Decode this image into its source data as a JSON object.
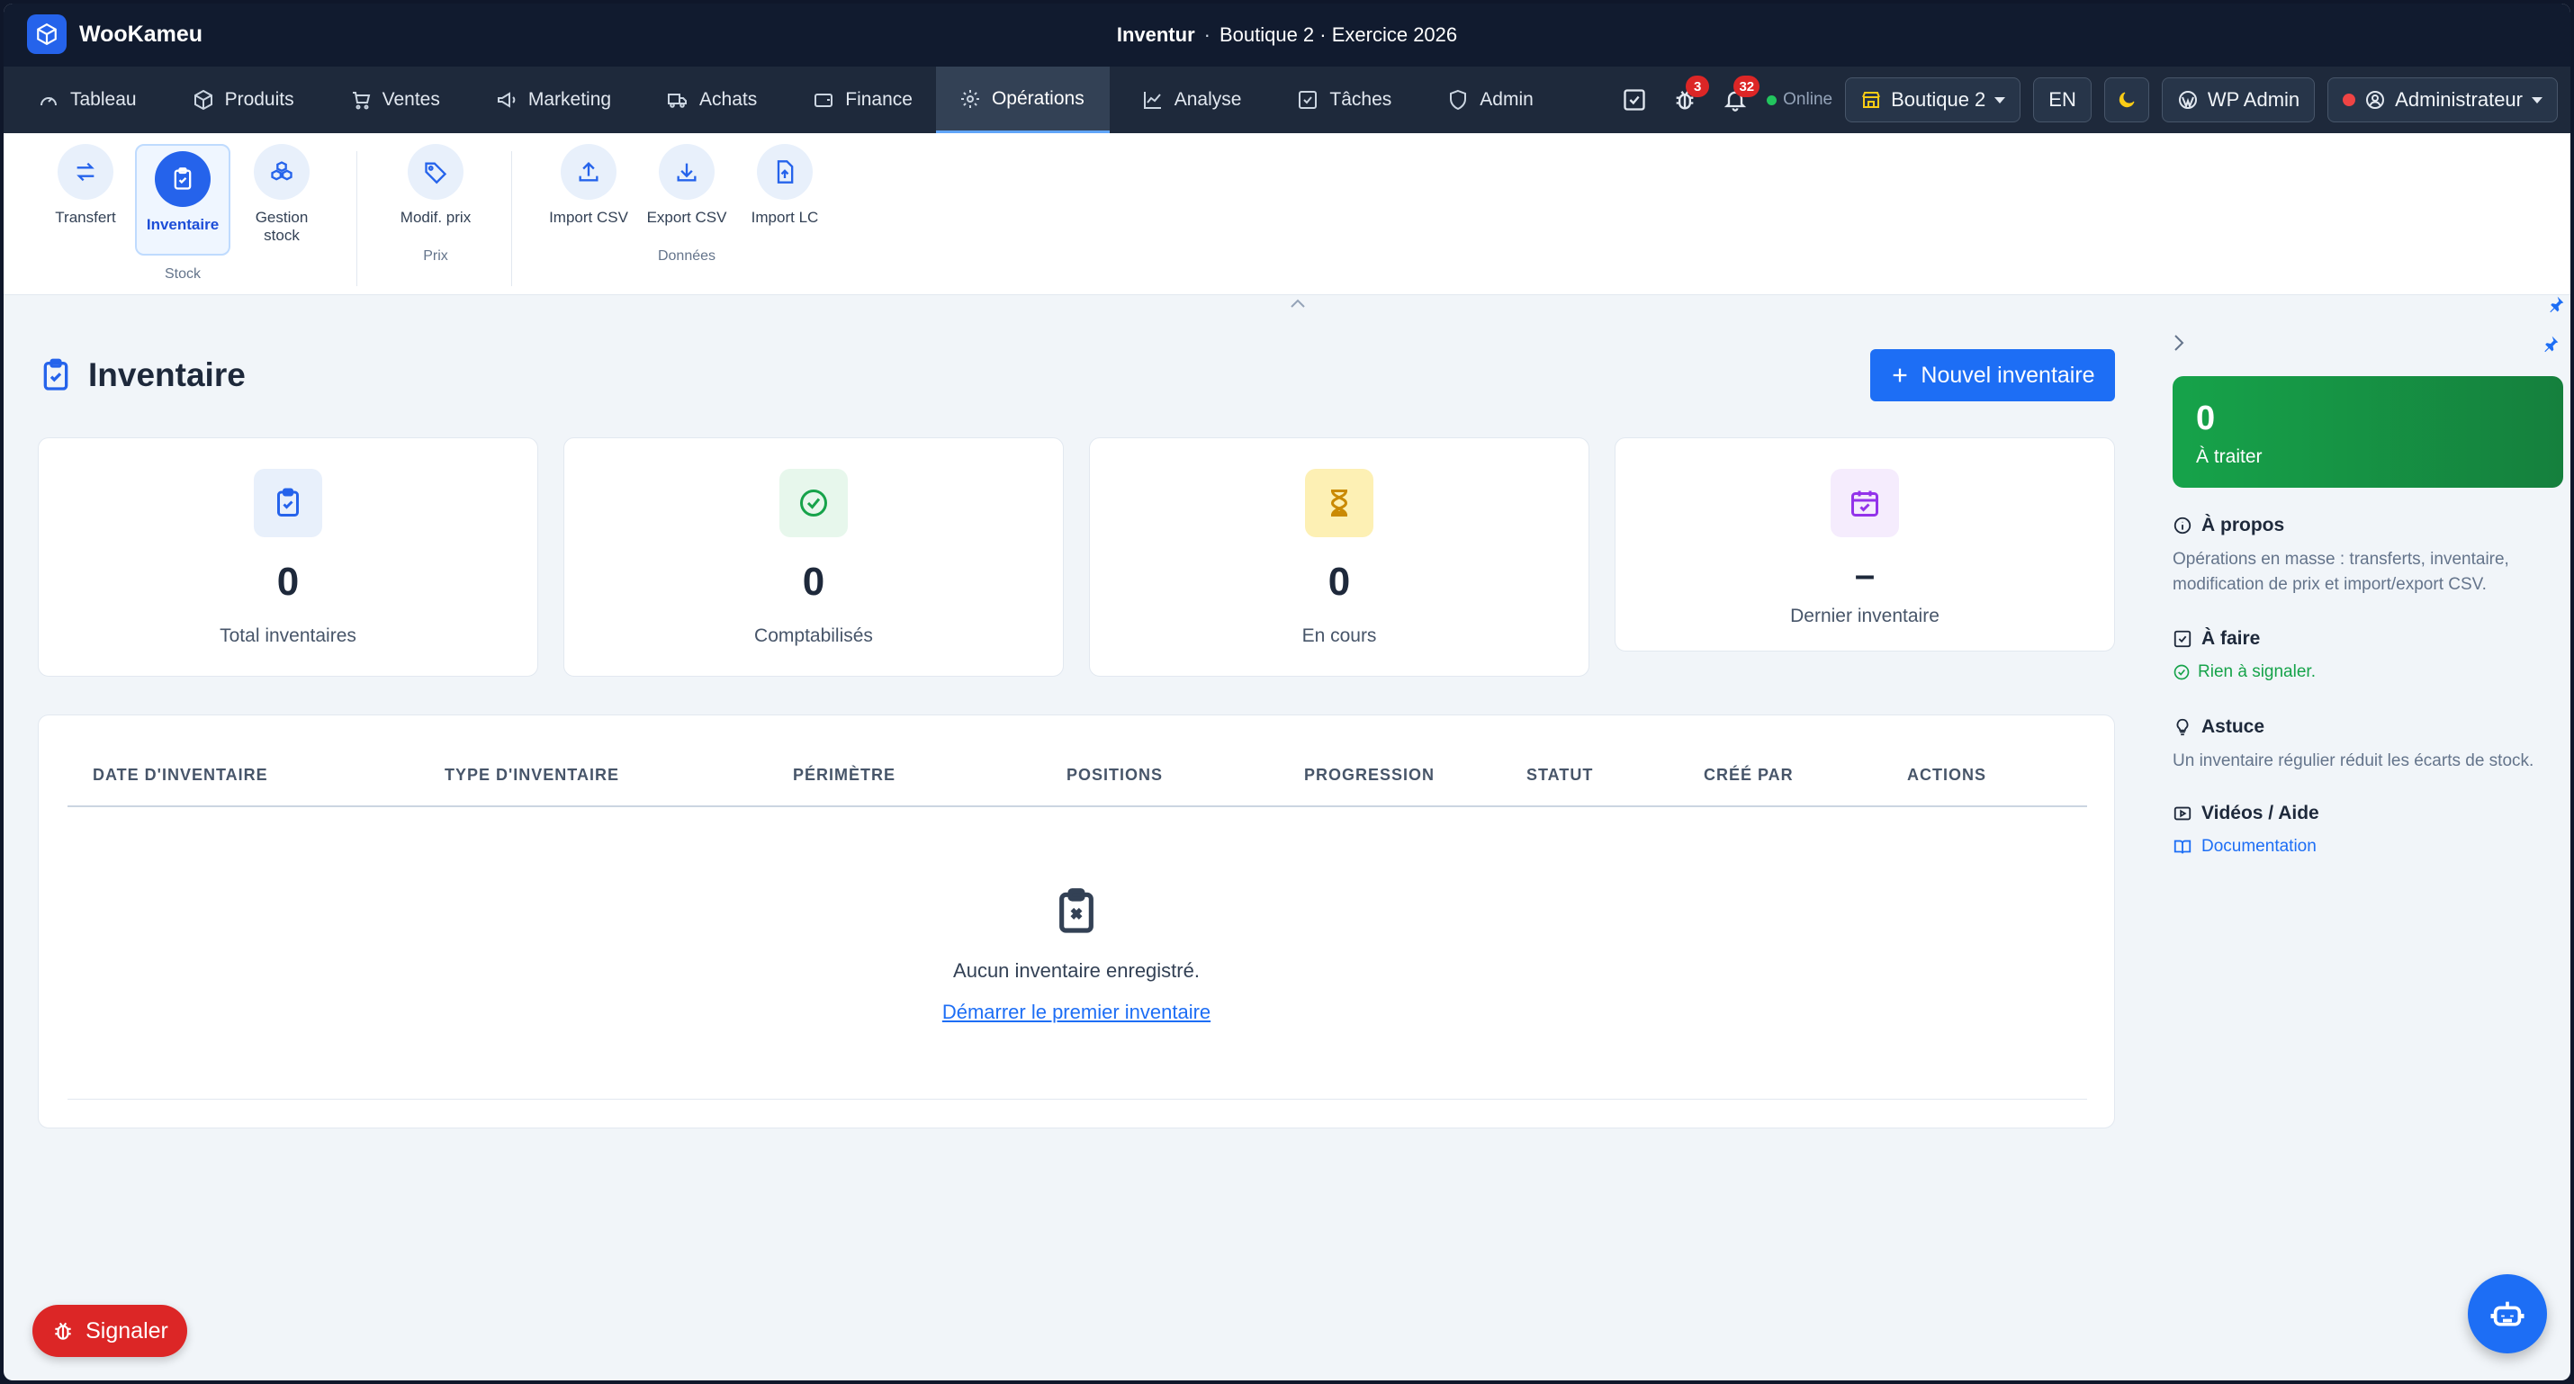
{
  "app": {
    "name": "WooKameu"
  },
  "window": {
    "title_bold": "Inventur",
    "title_rest": "Boutique 2 · Exercice 2026",
    "separator": "·"
  },
  "nav": {
    "items": [
      {
        "label": "Tableau",
        "icon": "gauge-icon"
      },
      {
        "label": "Produits",
        "icon": "box-icon"
      },
      {
        "label": "Ventes",
        "icon": "cart-icon"
      },
      {
        "label": "Marketing",
        "icon": "megaphone-icon"
      },
      {
        "label": "Achats",
        "icon": "truck-icon"
      },
      {
        "label": "Finance",
        "icon": "wallet-icon"
      },
      {
        "label": "Opérations",
        "icon": "gear-icon",
        "active": true
      },
      {
        "label": "Analyse",
        "icon": "chart-line-icon"
      },
      {
        "label": "Tâches",
        "icon": "checkbox-icon"
      },
      {
        "label": "Admin",
        "icon": "shield-icon"
      }
    ],
    "bug_badge": "3",
    "notif_badge": "32",
    "online": "Online",
    "store": "Boutique 2",
    "lang": "EN",
    "wp_admin": "WP Admin",
    "user": "Administrateur"
  },
  "ribbon": {
    "items": {
      "transfert": "Transfert",
      "inventaire": "Inventaire",
      "gestion_stock_line1": "Gestion",
      "gestion_stock_line2": "stock",
      "modif_prix": "Modif. prix",
      "import_csv": "Import CSV",
      "export_csv": "Export CSV",
      "import_lc": "Import LC"
    },
    "groups": {
      "stock": "Stock",
      "prix": "Prix",
      "donnees": "Données"
    }
  },
  "page": {
    "title": "Inventaire",
    "new_button": "Nouvel inventaire",
    "stats": [
      {
        "value": "0",
        "label": "Total inventaires",
        "color": "#2563eb"
      },
      {
        "value": "0",
        "label": "Comptabilisés",
        "color": "#16a34a"
      },
      {
        "value": "0",
        "label": "En cours",
        "color": "#ca8a04"
      },
      {
        "value": "–",
        "label": "Dernier inventaire",
        "color": "#9333ea"
      }
    ],
    "table": {
      "columns": [
        "DATE D'INVENTAIRE",
        "TYPE D'INVENTAIRE",
        "PÉRIMÈTRE",
        "POSITIONS",
        "PROGRESSION",
        "STATUT",
        "CRÉÉ PAR",
        "ACTIONS"
      ],
      "empty_text": "Aucun inventaire enregistré.",
      "empty_link": "Démarrer le premier inventaire"
    }
  },
  "side": {
    "todo_count": "0",
    "todo_label": "À traiter",
    "about_title": "À propos",
    "about_text": "Opérations en masse : transferts, inventaire, modification de prix et import/export CSV.",
    "afaire_title": "À faire",
    "afaire_text": "Rien à signaler.",
    "tip_title": "Astuce",
    "tip_text": "Un inventaire régulier réduit les écarts de stock.",
    "videos_title": "Vidéos / Aide",
    "doc_link": "Documentation"
  },
  "floating": {
    "report": "Signaler"
  },
  "colors": {
    "accent": "#1d6ef5",
    "nav_bg": "#1e293b",
    "title_bg": "#111b2f",
    "success": "#16a34a",
    "danger": "#dc2626"
  }
}
